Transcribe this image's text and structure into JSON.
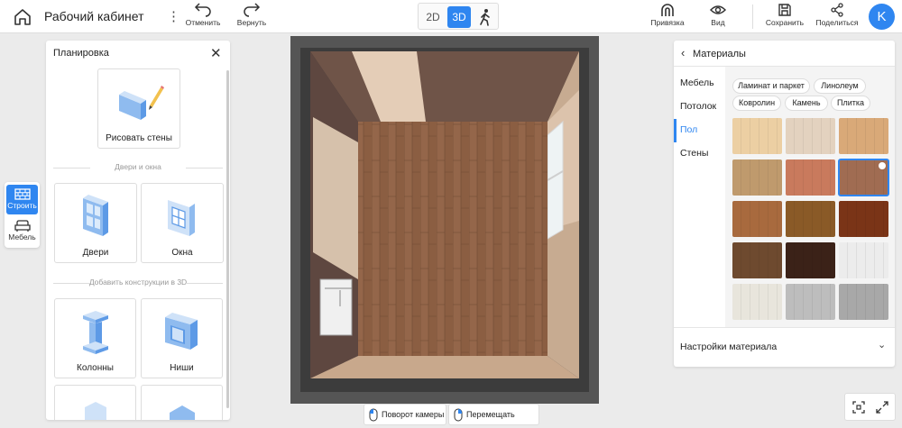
{
  "header": {
    "title": "Рабочий кабинет",
    "undo_label": "Отменить",
    "redo_label": "Вернуть",
    "mode_2d": "2D",
    "mode_3d": "3D",
    "snap_label": "Привязка",
    "view_label": "Вид",
    "save_label": "Сохранить",
    "share_label": "Поделиться",
    "avatar_letter": "K"
  },
  "rail": {
    "build_label": "Строить",
    "furniture_label": "Мебель"
  },
  "left_panel": {
    "title": "Планировка",
    "draw_walls": "Рисовать стены",
    "section_doors_windows": "Двери и окна",
    "doors": "Двери",
    "windows": "Окна",
    "section_constructions": "Добавить конструкции в 3D",
    "columns": "Колонны",
    "niches": "Ниши"
  },
  "hints": {
    "rotate_camera": "Поворот камеры",
    "move_scene": "Перемещать сцену"
  },
  "materials": {
    "title": "Материалы",
    "tabs": [
      "Мебель",
      "Потолок",
      "Пол",
      "Стены"
    ],
    "active_tab": "Пол",
    "chips": [
      "Ламинат и паркет",
      "Линолеум",
      "Ковролин",
      "Камень",
      "Плитка"
    ],
    "swatch_colors": [
      "#eccfa3",
      "#e3d2bf",
      "#d9a978",
      "#bf9a6d",
      "#c97a5d",
      "#a06c52",
      "#a86a3e",
      "#8a5a27",
      "#7a3417",
      "#6e4a2f",
      "#3b2218",
      "#ececec",
      "#e8e5dc",
      "#bdbdbd",
      "#a8a8a8"
    ],
    "selected_index": 5,
    "settings_label": "Настройки материала"
  },
  "colors": {
    "accent": "#2f86f0",
    "floor": "#8b5e42",
    "wall_side": "#c7ab91",
    "wall_dark": "#6f5448"
  }
}
